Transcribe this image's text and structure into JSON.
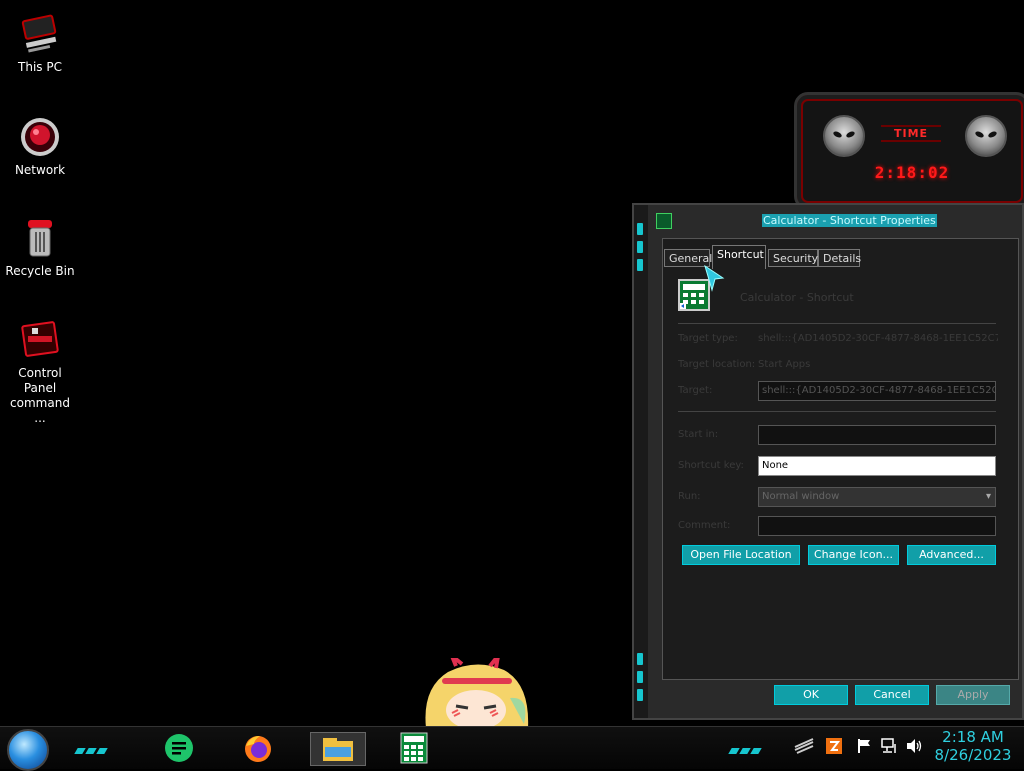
{
  "desktop": {
    "icons": [
      {
        "label": "This PC"
      },
      {
        "label": "Network"
      },
      {
        "label": "Recycle Bin"
      },
      {
        "label": "Control Panel command ..."
      }
    ]
  },
  "gadget": {
    "label": "TIME",
    "time": "2:18:02"
  },
  "window": {
    "title": "Calculator - Shortcut Properties",
    "tabs": [
      "General",
      "Shortcut",
      "Security",
      "Details"
    ],
    "active_tab": "Shortcut",
    "shortcut_name": "Calculator - Shortcut",
    "fields": {
      "target_type_label": "Target type:",
      "target_type_value": "shell:::{AD1405D2-30CF-4877-8468-1EE1C52C75",
      "target_location_label": "Target location:",
      "target_location_value": "Start Apps",
      "target_label": "Target:",
      "target_value": "shell:::{AD1405D2-30CF-4877-8468-1EE1C52C75",
      "start_in_label": "Start in:",
      "start_in_value": "",
      "shortcut_key_label": "Shortcut key:",
      "shortcut_key_value": "None",
      "run_label": "Run:",
      "run_value": "Normal window",
      "comment_label": "Comment:",
      "comment_value": ""
    },
    "buttons": {
      "open_file_location": "Open File Location",
      "change_icon": "Change Icon...",
      "advanced": "Advanced...",
      "ok": "OK",
      "cancel": "Cancel",
      "apply": "Apply"
    }
  },
  "taskbar": {
    "time": "2:18 AM",
    "date": "8/26/2023"
  },
  "colors": {
    "accent": "#16c6cf",
    "clock_red": "#ff1a1a"
  }
}
